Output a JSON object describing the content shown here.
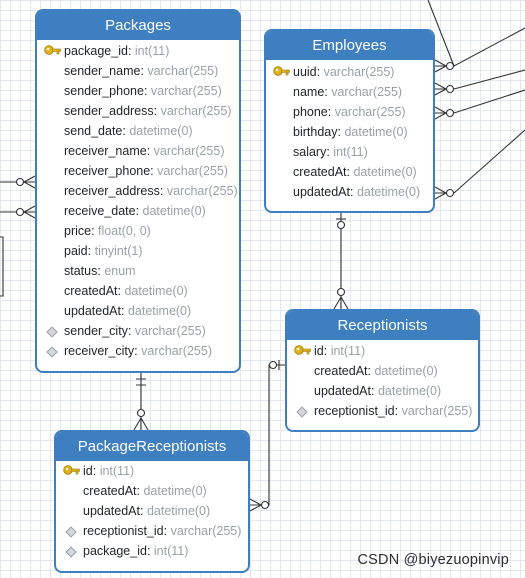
{
  "entities": {
    "packages": {
      "title": "Packages",
      "fields": [
        {
          "name": "package_id",
          "type": "int(11)",
          "marker": "key"
        },
        {
          "name": "sender_name",
          "type": "varchar(255)",
          "marker": ""
        },
        {
          "name": "sender_phone",
          "type": "varchar(255)",
          "marker": ""
        },
        {
          "name": "sender_address",
          "type": "varchar(255)",
          "marker": ""
        },
        {
          "name": "send_date",
          "type": "datetime(0)",
          "marker": ""
        },
        {
          "name": "receiver_name",
          "type": "varchar(255)",
          "marker": ""
        },
        {
          "name": "receiver_phone",
          "type": "varchar(255)",
          "marker": ""
        },
        {
          "name": "receiver_address",
          "type": "varchar(255)",
          "marker": ""
        },
        {
          "name": "receive_date",
          "type": "datetime(0)",
          "marker": ""
        },
        {
          "name": "price",
          "type": "float(0, 0)",
          "marker": ""
        },
        {
          "name": "paid",
          "type": "tinyint(1)",
          "marker": ""
        },
        {
          "name": "status",
          "type": "enum",
          "marker": ""
        },
        {
          "name": "createdAt",
          "type": "datetime(0)",
          "marker": ""
        },
        {
          "name": "updatedAt",
          "type": "datetime(0)",
          "marker": ""
        },
        {
          "name": "sender_city",
          "type": "varchar(255)",
          "marker": "index"
        },
        {
          "name": "receiver_city",
          "type": "varchar(255)",
          "marker": "index"
        }
      ]
    },
    "employees": {
      "title": "Employees",
      "fields": [
        {
          "name": "uuid",
          "type": "varchar(255)",
          "marker": "key"
        },
        {
          "name": "name",
          "type": "varchar(255)",
          "marker": ""
        },
        {
          "name": "phone",
          "type": "varchar(255)",
          "marker": ""
        },
        {
          "name": "birthday",
          "type": "datetime(0)",
          "marker": ""
        },
        {
          "name": "salary",
          "type": "int(11)",
          "marker": ""
        },
        {
          "name": "createdAt",
          "type": "datetime(0)",
          "marker": ""
        },
        {
          "name": "updatedAt",
          "type": "datetime(0)",
          "marker": ""
        }
      ]
    },
    "receptionists": {
      "title": "Receptionists",
      "fields": [
        {
          "name": "id",
          "type": "int(11)",
          "marker": "key"
        },
        {
          "name": "createdAt",
          "type": "datetime(0)",
          "marker": ""
        },
        {
          "name": "updatedAt",
          "type": "datetime(0)",
          "marker": ""
        },
        {
          "name": "receptionist_id",
          "type": "varchar(255)",
          "marker": "index"
        }
      ]
    },
    "package_receptionists": {
      "title": "PackageReceptionists",
      "fields": [
        {
          "name": "id",
          "type": "int(11)",
          "marker": "key"
        },
        {
          "name": "createdAt",
          "type": "datetime(0)",
          "marker": ""
        },
        {
          "name": "updatedAt",
          "type": "datetime(0)",
          "marker": ""
        },
        {
          "name": "receptionist_id",
          "type": "varchar(255)",
          "marker": "index"
        },
        {
          "name": "package_id",
          "type": "int(11)",
          "marker": "index"
        }
      ]
    }
  },
  "watermark": "CSDN @biyezuopinvip",
  "colors": {
    "header": "#3d7fc1",
    "border": "#3d7fc1",
    "line": "#333333",
    "key_icon": "#e0b21a",
    "type_text": "#9aa0a8"
  },
  "icons": {
    "primary_key": "key-icon",
    "index": "index-diamond-icon"
  }
}
